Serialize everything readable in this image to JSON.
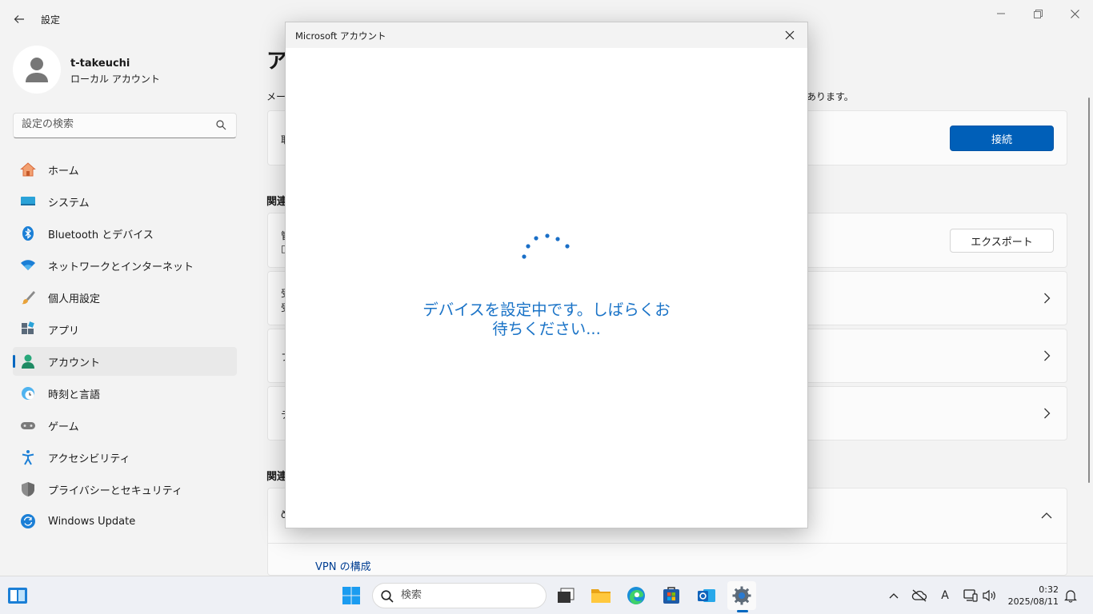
{
  "window": {
    "title": "設定",
    "minimize_glyph": "—",
    "maximize_glyph": "❐",
    "close_glyph": "✕"
  },
  "profile": {
    "name": "t-takeuchi",
    "account_type": "ローカル アカウント"
  },
  "search": {
    "placeholder": "設定の検索"
  },
  "nav": {
    "items": [
      {
        "label": "ホーム",
        "icon": "home-icon"
      },
      {
        "label": "システム",
        "icon": "system-icon"
      },
      {
        "label": "Bluetooth とデバイス",
        "icon": "bluetooth-icon"
      },
      {
        "label": "ネットワークとインターネット",
        "icon": "wifi-icon"
      },
      {
        "label": "個人用設定",
        "icon": "brush-icon"
      },
      {
        "label": "アプリ",
        "icon": "apps-icon"
      },
      {
        "label": "アカウント",
        "icon": "account-icon"
      },
      {
        "label": "時刻と言語",
        "icon": "time-language-icon"
      },
      {
        "label": "ゲーム",
        "icon": "gamepad-icon"
      },
      {
        "label": "アクセシビリティ",
        "icon": "accessibility-icon"
      },
      {
        "label": "プライバシーとセキュリティ",
        "icon": "shield-icon"
      },
      {
        "label": "Windows Update",
        "icon": "update-icon"
      }
    ],
    "active_index": 6
  },
  "main": {
    "heading": "ア",
    "desc_left": "メー",
    "desc_right": "あります。",
    "card1_text": "取",
    "connect_button": "接続",
    "related_label": "関連",
    "card2_line1": "管",
    "card2_line2": "□",
    "export_button": "エクスポート",
    "card3_line1": "受",
    "card3_line2": "受",
    "card4_text": "フ",
    "card5_text": "テ",
    "related_label2": "関連",
    "card6_text": "ð",
    "vpn_link": "VPN の構成"
  },
  "dialog": {
    "title": "Microsoft アカウント",
    "message_line1": "デバイスを設定中です。しばらくお",
    "message_line2": "待ちください..."
  },
  "taskbar": {
    "search_placeholder": "検索",
    "apps": [
      "widgets-icon",
      "start-icon",
      "search-icon",
      "task-view-icon",
      "file-explorer-icon",
      "edge-icon",
      "store-icon",
      "outlook-icon",
      "settings-icon"
    ],
    "clock_time": "0:32",
    "clock_date": "2025/08/11",
    "ime_label": "A"
  },
  "colors": {
    "accent": "#0067c0",
    "primary_button": "#005fb8",
    "dialog_message": "#1a73c7"
  }
}
